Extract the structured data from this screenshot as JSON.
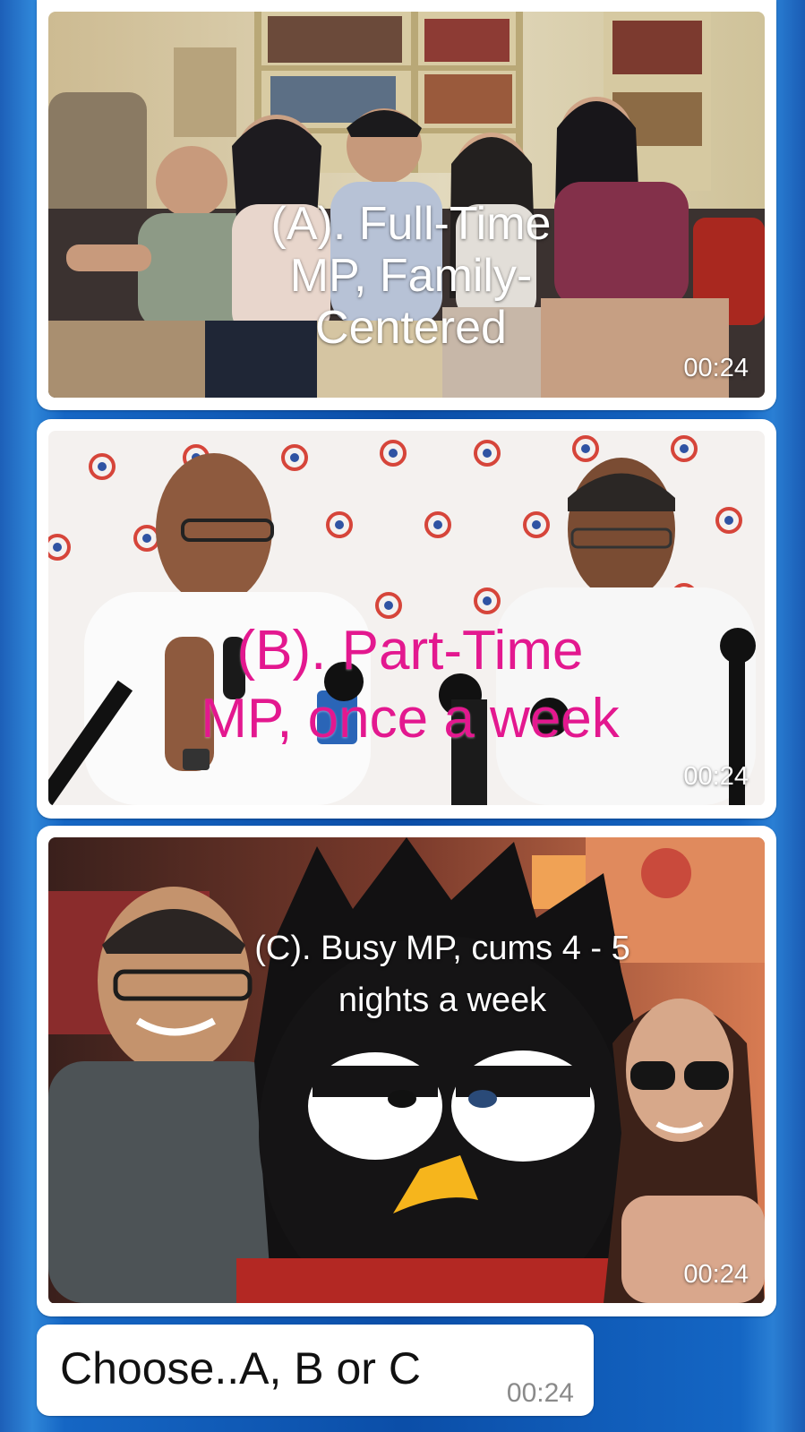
{
  "messages": [
    {
      "caption": "(A). Full-Time\nMP, Family-\nCentered",
      "time": "00:24"
    },
    {
      "caption": "(B). Part-Time\nMP, once a week",
      "time": "00:24"
    },
    {
      "caption": "(C). Busy MP, cums 4 - 5\nnights a week",
      "time": "00:24"
    }
  ],
  "text_message": {
    "body": "Choose..A, B or C",
    "time": "00:24"
  }
}
